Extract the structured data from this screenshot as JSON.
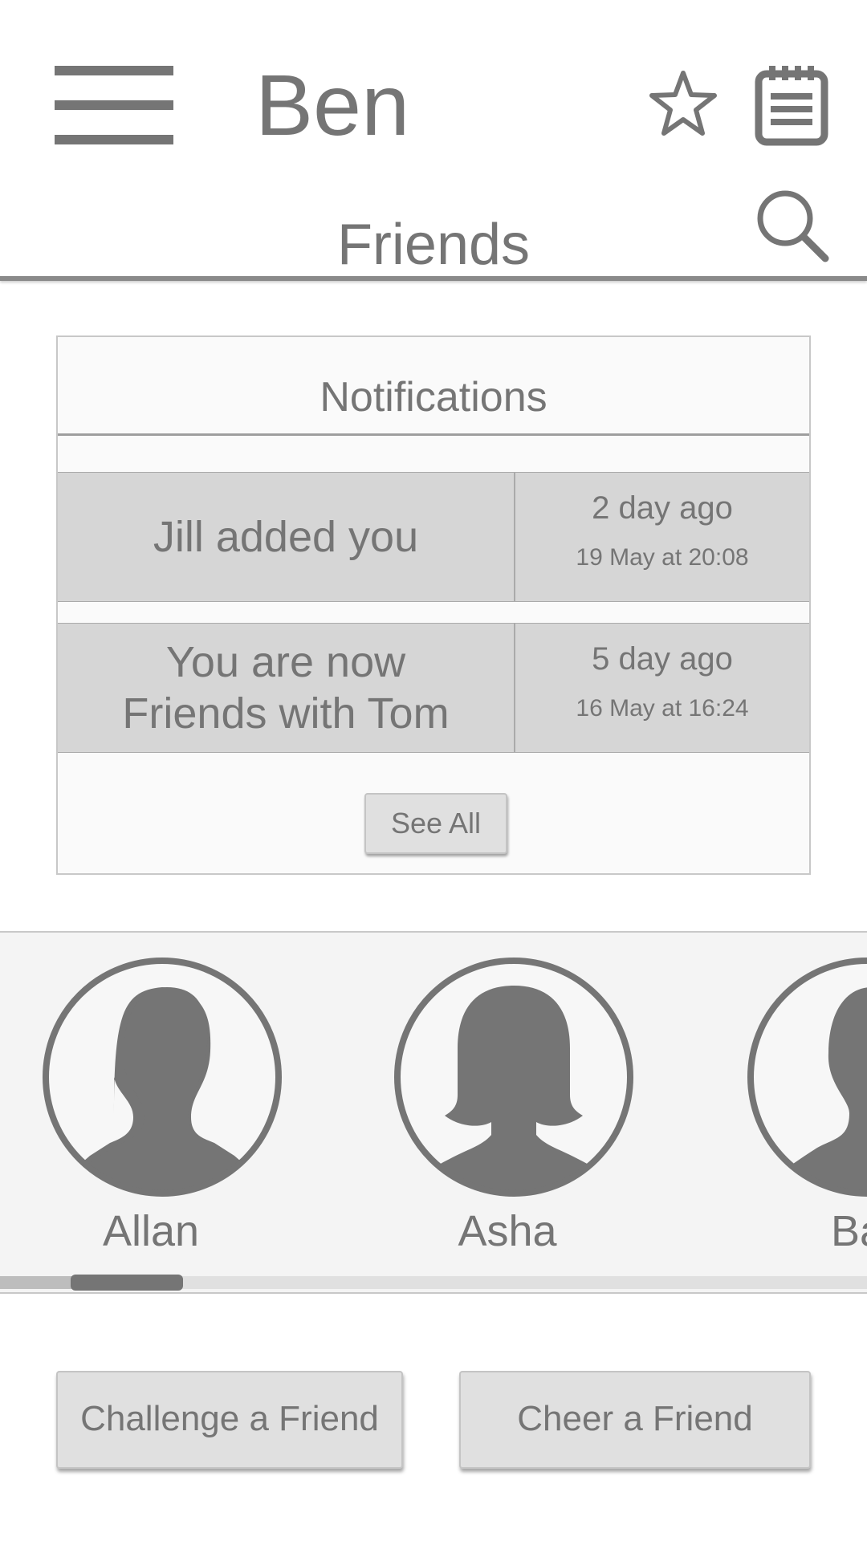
{
  "header": {
    "user_name": "Ben",
    "page_title": "Friends",
    "icons": [
      "menu-icon",
      "star-icon",
      "calendar-icon",
      "search-icon"
    ]
  },
  "notifications": {
    "title": "Notifications",
    "items": [
      {
        "message": "Jill added you",
        "relative_time": "2 day ago",
        "date": "19 May at 20:08"
      },
      {
        "message": "You are now\nFriends with Tom",
        "relative_time": "5 day ago",
        "date": "16 May at 16:24"
      }
    ],
    "see_all_label": "See All"
  },
  "friends": [
    {
      "name": "Allan",
      "avatar": "male-avatar-icon"
    },
    {
      "name": "Asha",
      "avatar": "female-avatar-icon"
    },
    {
      "name": "Ba",
      "avatar": "male-avatar-icon"
    }
  ],
  "actions": {
    "challenge_label": "Challenge a Friend",
    "cheer_label": "Cheer a Friend"
  },
  "colors": {
    "foreground": "#757575",
    "row_background": "#d6d6d6",
    "button_background": "#e0e0e0",
    "carousel_background": "#f4f4f4"
  }
}
